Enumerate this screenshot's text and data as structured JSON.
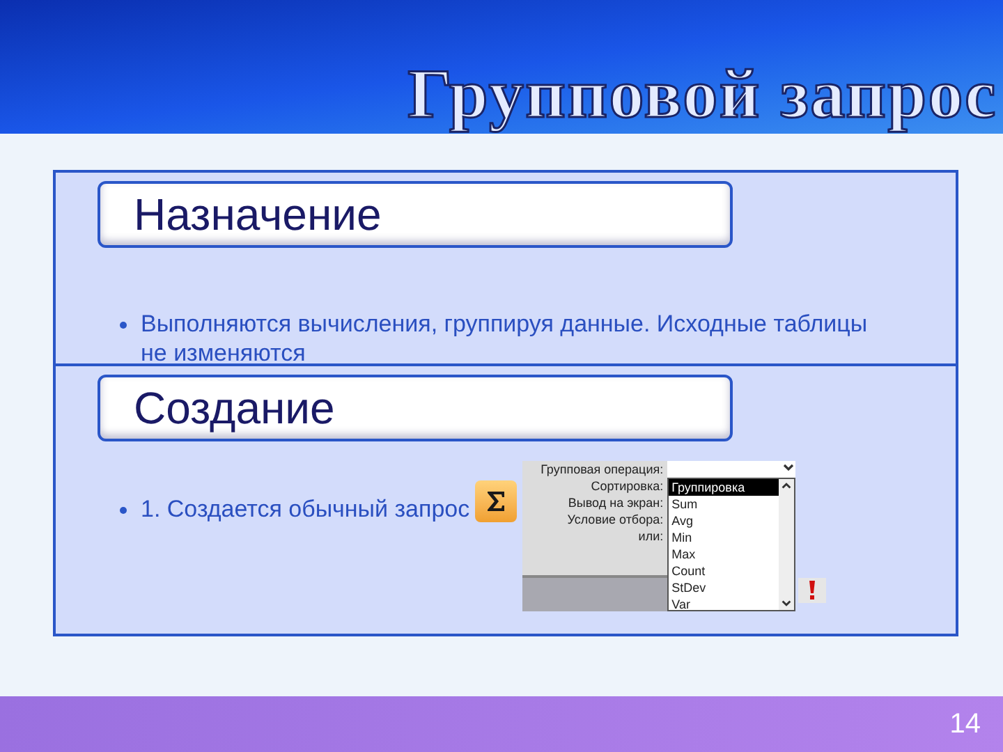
{
  "title": "Групповой запрос",
  "sections": [
    {
      "heading": "Назначение",
      "bullets": [
        "Выполняются вычисления, группируя данные. Исходные таблицы не изменяются"
      ]
    },
    {
      "heading": "Создание",
      "bullets": [
        "1. Создается обычный запрос"
      ],
      "inset": {
        "row_labels": [
          "Групповая операция:",
          "Сортировка:",
          "Вывод на экран:",
          "Условие отбора:",
          "или:"
        ],
        "options": [
          {
            "label": "Группировка",
            "selected": true
          },
          {
            "label": "Sum",
            "selected": false
          },
          {
            "label": "Avg",
            "selected": false
          },
          {
            "label": "Min",
            "selected": false
          },
          {
            "label": "Max",
            "selected": false
          },
          {
            "label": "Count",
            "selected": false
          },
          {
            "label": "StDev",
            "selected": false
          },
          {
            "label": "Var",
            "selected": false
          }
        ]
      }
    }
  ],
  "page_number": "14"
}
